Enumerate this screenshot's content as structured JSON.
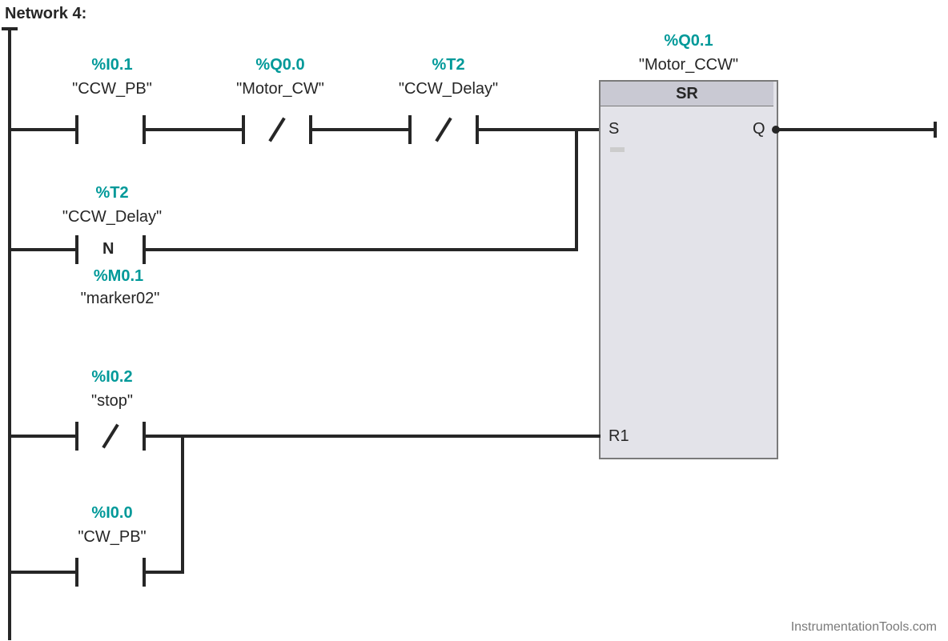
{
  "network": {
    "title": "Network 4:"
  },
  "contacts": {
    "ccw_pb": {
      "addr": "%I0.1",
      "sym": "\"CCW_PB\""
    },
    "motor_cw": {
      "addr": "%Q0.0",
      "sym": "\"Motor_CW\""
    },
    "ccw_delay_top": {
      "addr": "%T2",
      "sym": "\"CCW_Delay\""
    },
    "ccw_delay_edge": {
      "addr": "%T2",
      "sym": "\"CCW_Delay\"",
      "edge": "N"
    },
    "marker02": {
      "addr": "%M0.1",
      "sym": "\"marker02\""
    },
    "stop": {
      "addr": "%I0.2",
      "sym": "\"stop\""
    },
    "cw_pb": {
      "addr": "%I0.0",
      "sym": "\"CW_PB\""
    }
  },
  "sr": {
    "addr": "%Q0.1",
    "sym": "\"Motor_CCW\"",
    "type": "SR",
    "pin_s": "S",
    "pin_q": "Q",
    "pin_r": "R1"
  },
  "footer": "InstrumentationTools.com"
}
